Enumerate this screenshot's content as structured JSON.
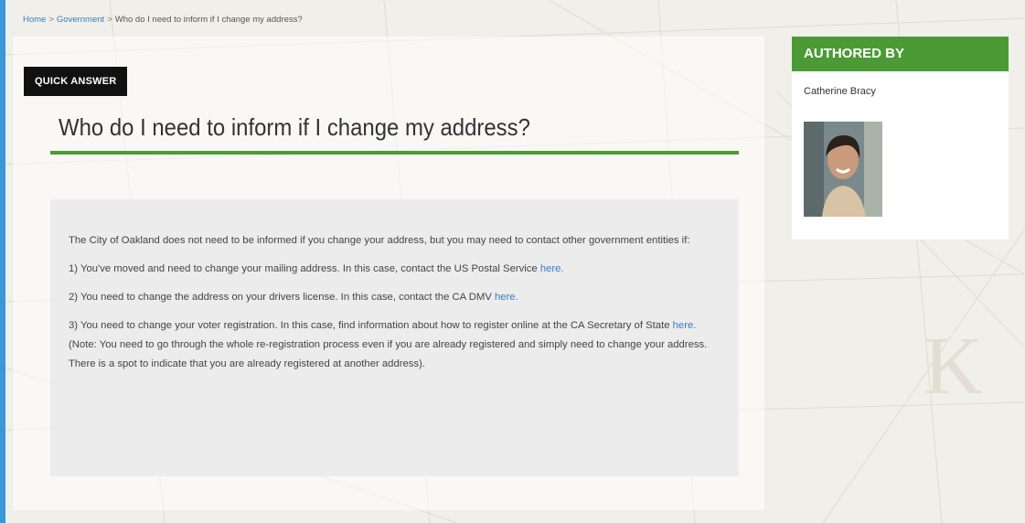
{
  "breadcrumb": {
    "home": "Home",
    "sep1": ">",
    "section": "Government",
    "sep2": ">",
    "current": "Who do I need to inform if I change my address?"
  },
  "badge": "QUICK ANSWER",
  "title": "Who do I need to inform if I change my address?",
  "answer": {
    "intro": "The City of Oakland does not need to be informed if you change your address, but you may need to contact other government entities if:",
    "item1_text": "1) You've moved and need to change your mailing address. In this case, contact the US Postal Service ",
    "item1_link": "here.",
    "item2_text": "2) You need to change the address on your drivers license. In this case, contact the CA DMV ",
    "item2_link": "here.",
    "item3_text": "3) You need to change your voter registration. In this case, find information about how to register online at the CA Secretary of State ",
    "item3_link": "here.",
    "item3_note": " (Note: You need to go through the whole re-registration process even if you are already registered and simply need to change your address. There is a spot to indicate that you are already registered at another address)."
  },
  "sidebar": {
    "header": "AUTHORED BY",
    "author": "Catherine Bracy",
    "avatar_icon": "author-photo"
  },
  "colors": {
    "accent_green": "#4c9a35",
    "link_blue": "#3a7cc0",
    "left_bar_blue": "#3a97d8",
    "badge_black": "#111111"
  }
}
